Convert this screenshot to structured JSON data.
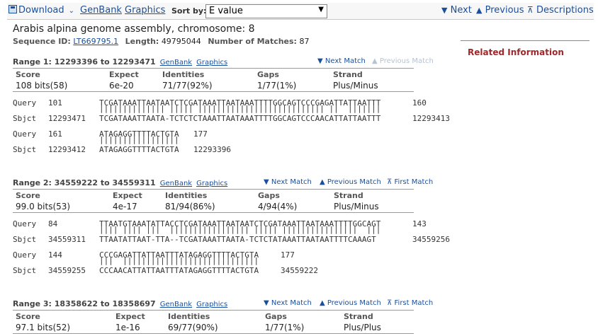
{
  "toolbar": {
    "download": "Download",
    "genbank": "GenBank",
    "graphics": "Graphics",
    "sort_label": "Sort by:",
    "sort_value": "E value",
    "next": "Next",
    "previous": "Previous",
    "descriptions": "Descriptions"
  },
  "header": {
    "title": "Arabis alpina genome assembly, chromosome: 8",
    "seq_id_label": "Sequence ID:",
    "seq_id": "LT669795.1",
    "length_label": "Length:",
    "length": "49795044",
    "matches_label": "Number of Matches:",
    "matches": "87"
  },
  "related": {
    "title": "Related Information"
  },
  "labels": {
    "score": "Score",
    "expect": "Expect",
    "identities": "Identities",
    "gaps": "Gaps",
    "strand": "Strand",
    "genbank": "GenBank",
    "graphics": "Graphics",
    "next_match": "Next Match",
    "previous_match": "Previous Match",
    "first_match": "First Match",
    "query": "Query",
    "sbjct": "Sbjct"
  },
  "ranges": [
    {
      "title": "Range 1: 12293396 to 12293471",
      "score": "108 bits(58)",
      "expect": "6e-20",
      "identities": "71/77(92%)",
      "gaps": "1/77(1%)",
      "strand": "Plus/Minus",
      "blocks": [
        {
          "q_start": "101",
          "q_seq": "TCGATAAATTAATAATCTCGATAAATTAATAAATTTTGGCAGTCCCGAGATTATTAATTT",
          "q_end": "160",
          "bars": "|||||||||||||| ||||| ||||||||||||||||||||||||||| ||  |||||||",
          "s_start": "12293471",
          "s_seq": "TCGATAAATTAATA-TCTCTCTAAATTAATAAATTTTGGCAGTCCCAACATTATTAATTT",
          "s_end": "12293413"
        },
        {
          "q_start": "161",
          "q_seq": "ATAGAGGTTTTACTGTA",
          "q_end": "177",
          "bars": "|||||||||||||||||",
          "s_start": "12293412",
          "s_seq": "ATAGAGGTTTTACTGTA",
          "s_end": "12293396"
        }
      ]
    },
    {
      "title": "Range 2: 34559222 to 34559311",
      "score": "99.0 bits(53)",
      "expect": "4e-17",
      "identities": "81/94(86%)",
      "gaps": "4/94(4%)",
      "strand": "Plus/Minus",
      "blocks": [
        {
          "q_start": "84",
          "q_seq": "TTAATGTAAATATTACCTCGATAAATTAATAATCTCGATAAATTAATAAATTTTGGCAGT",
          "q_end": "143",
          "bars": "|||| |||| |||  ||||||||||||||||| ||||| ||||||||||||||||  |||",
          "s_start": "34559311",
          "s_seq": "TTAATATTAAT-TTA--TCGATAAATTAATA-TCTCTATAAATTAATAATTTTCAAAGT",
          "s_end": "34559256"
        },
        {
          "q_start": "144",
          "q_seq": "CCCGAGATTATTAATTTATAGAGGTTTTACTGTA",
          "q_end": "177",
          "bars": "|||  |||||||||||||||||||||||||||||",
          "s_start": "34559255",
          "s_seq": "CCCAACATTATTAATTTATAGAGGTTTTACTGTA",
          "s_end": "34559222"
        }
      ]
    },
    {
      "title": "Range 3: 18358622 to 18358697",
      "score": "97.1 bits(52)",
      "expect": "1e-16",
      "identities": "69/77(90%)",
      "gaps": "1/77(1%)",
      "strand": "Plus/Plus",
      "blocks": []
    }
  ]
}
